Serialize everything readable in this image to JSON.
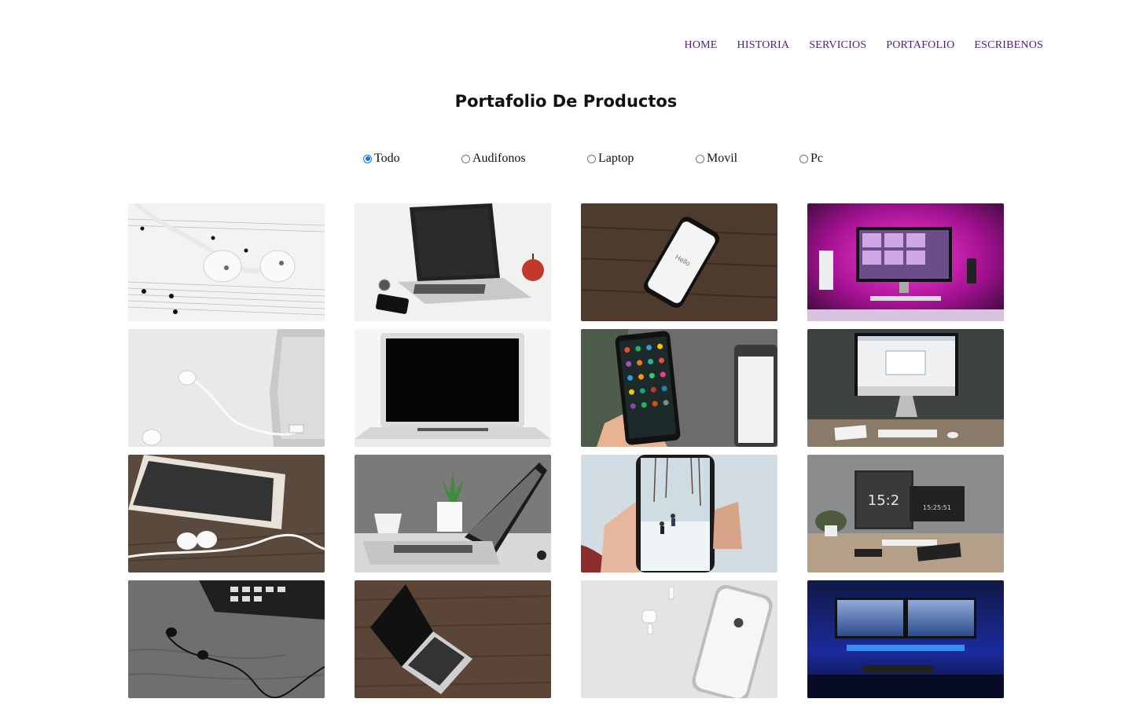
{
  "nav": {
    "items": [
      {
        "label": "HOME"
      },
      {
        "label": "HISTORIA"
      },
      {
        "label": "SERVICIOS"
      },
      {
        "label": "PORTAFOLIO"
      },
      {
        "label": "ESCRIBENOS"
      }
    ]
  },
  "page_title": "Portafolio De Productos",
  "filters": [
    {
      "label": "Todo",
      "checked": true
    },
    {
      "label": "Audifonos",
      "checked": false
    },
    {
      "label": "Laptop",
      "checked": false
    },
    {
      "label": "Movil",
      "checked": false
    },
    {
      "label": "Pc",
      "checked": false
    }
  ],
  "gallery": [
    {
      "category": "audifonos",
      "subject": "white earbuds on sheet music"
    },
    {
      "category": "laptop",
      "subject": "laptop with phone and apple"
    },
    {
      "category": "movil",
      "subject": "phone on wooden table"
    },
    {
      "category": "pc",
      "subject": "desktop with pink lighting"
    },
    {
      "category": "audifonos",
      "subject": "earphones and phone on white"
    },
    {
      "category": "laptop",
      "subject": "open laptop on white"
    },
    {
      "category": "movil",
      "subject": "hand holding android phone"
    },
    {
      "category": "pc",
      "subject": "imac on desk"
    },
    {
      "category": "audifonos",
      "subject": "earphones with iphone on wood"
    },
    {
      "category": "laptop",
      "subject": "laptop with mug and plant"
    },
    {
      "category": "movil",
      "subject": "hand holding phone in snow"
    },
    {
      "category": "pc",
      "subject": "dual monitors desk setup"
    },
    {
      "category": "audifonos",
      "subject": "black earphones monochrome"
    },
    {
      "category": "laptop",
      "subject": "laptop on dark wood"
    },
    {
      "category": "movil",
      "subject": "airpods and iphone"
    },
    {
      "category": "pc",
      "subject": "blue lit gaming setup"
    }
  ],
  "colors": {
    "nav_link": "#4b1e7e",
    "radio_accent": "#1a73e8"
  },
  "clock_text": "15:2",
  "clock_text_small": "15:25:51",
  "phone_text": "Hello"
}
